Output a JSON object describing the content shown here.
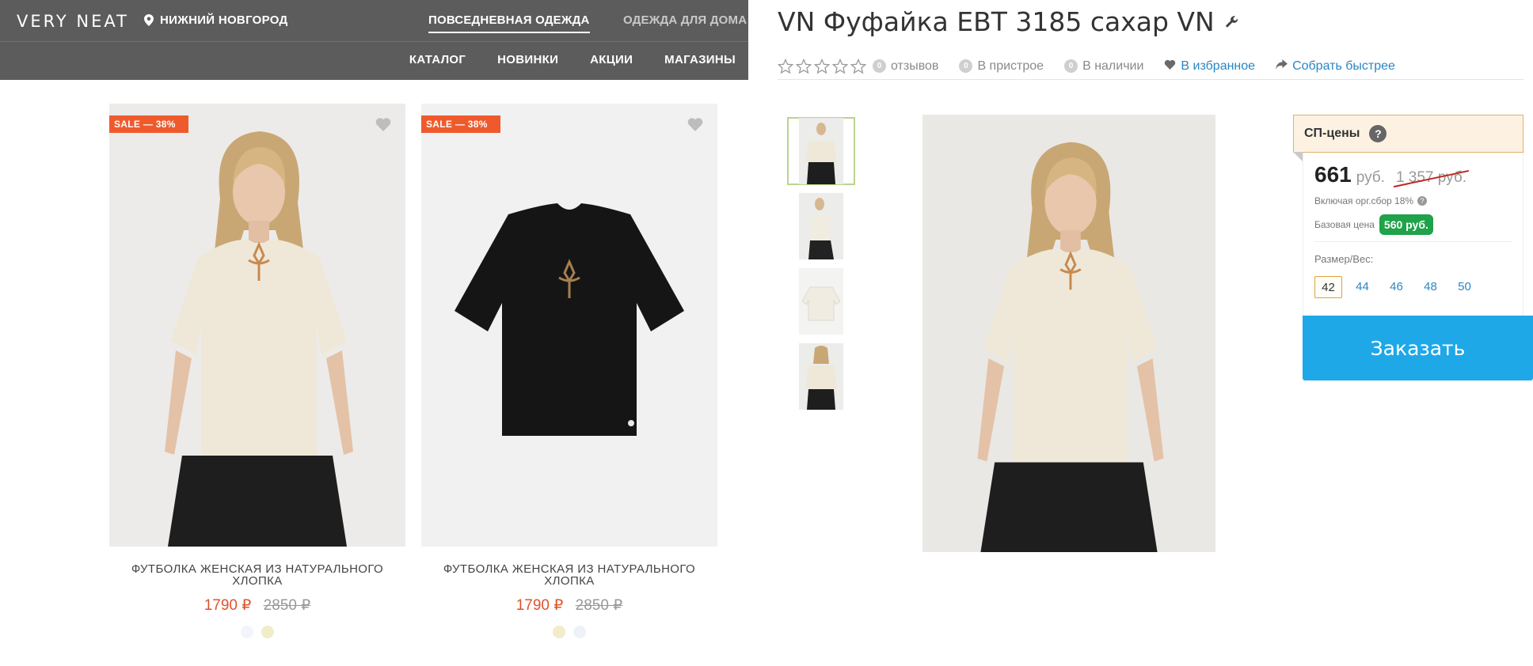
{
  "store": {
    "logo": "VERY NEAT",
    "city": "НИЖНИЙ НОВГОРОД",
    "tabs": [
      "ПОВСЕДНЕВНАЯ ОДЕЖДА",
      "ОДЕЖДА ДЛЯ ДОМА"
    ],
    "subnav": [
      "КАТАЛОГ",
      "НОВИНКИ",
      "АКЦИИ",
      "МАГАЗИНЫ"
    ],
    "products": [
      {
        "badge": "SALE — 38%",
        "title": "ФУТБОЛКА ЖЕНСКАЯ ИЗ НАТУРАЛЬНОГО ХЛОПКА",
        "price": "1790 ₽",
        "old_price": "2850 ₽",
        "swatches": [
          "#f1f5fb",
          "#f1ecc9"
        ]
      },
      {
        "badge": "SALE — 38%",
        "title": "ФУТБОЛКА ЖЕНСКАЯ ИЗ НАТУРАЛЬНОГО ХЛОПКА",
        "price": "1790 ₽",
        "old_price": "2850 ₽",
        "swatches": [
          "#f1ecc9",
          "#eef2f8"
        ]
      }
    ]
  },
  "product": {
    "title": "VN Фуфайка ЕВТ 3185 сахар VN",
    "reviews_count": "0",
    "reviews_label": "отзывов",
    "pristroy_count": "0",
    "pristroy_label": "В пристрое",
    "stock_count": "0",
    "stock_label": "В наличии",
    "favorite_label": "В избранное",
    "share_label": "Собрать быстрее",
    "rating_stars": 0,
    "buybox": {
      "header": "СП-цены",
      "price": "661",
      "currency": "руб.",
      "old_price": "1 357 руб.",
      "fee_text": "Включая орг.сбор 18%",
      "base_label": "Базовая цена",
      "base_price": "560 руб.",
      "size_label": "Размер/Вес:",
      "sizes": [
        "42",
        "44",
        "46",
        "48",
        "50"
      ],
      "selected_size": "42",
      "order_label": "Заказать"
    }
  },
  "colors": {
    "sale": "#ef5a2d",
    "price": "#e0522a",
    "link": "#2a86c4",
    "order": "#1ea8e8",
    "base_badge": "#1fa24a"
  }
}
